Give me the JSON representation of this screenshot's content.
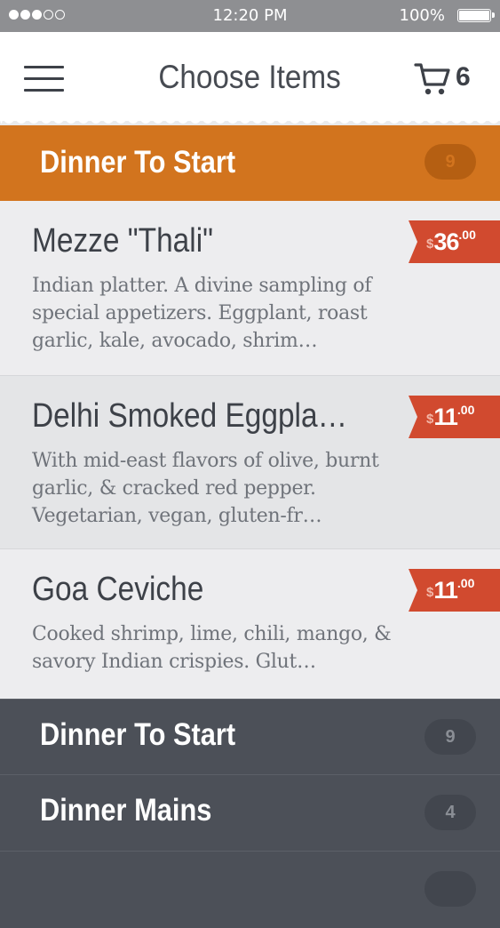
{
  "status_bar": {
    "time": "12:20 PM",
    "battery": "100%",
    "signal_bars_filled": 3,
    "signal_bars_total": 5
  },
  "header": {
    "title": "Choose Items",
    "cart_count": "6"
  },
  "active_category": {
    "label": "Dinner To Start",
    "count": "9"
  },
  "items": [
    {
      "name": "Mezze \"Thali\"",
      "description": "Indian platter. A divine sampling of special appetizers. Eggplant, roast garlic, kale, avocado, shrim…",
      "currency": "$",
      "price": "36",
      "cents": ".00"
    },
    {
      "name": "Delhi Smoked Eggpla…",
      "description": "With mid-east flavors of olive, burnt garlic, & cracked red pepper. Vegetarian, vegan, gluten-fr…",
      "currency": "$",
      "price": "11",
      "cents": ".00"
    },
    {
      "name": "Goa Ceviche",
      "description": "Cooked shrimp, lime, chili, mango, & savory Indian crispies. Glut…",
      "currency": "$",
      "price": "11",
      "cents": ".00"
    }
  ],
  "categories": [
    {
      "label": "Dinner To Start",
      "count": "9"
    },
    {
      "label": "Dinner Mains",
      "count": "4"
    },
    {
      "label": "",
      "count": ""
    }
  ],
  "colors": {
    "accent_orange": "#d2741e",
    "price_red": "#d14a2f",
    "dark_panel": "#4c5058"
  }
}
